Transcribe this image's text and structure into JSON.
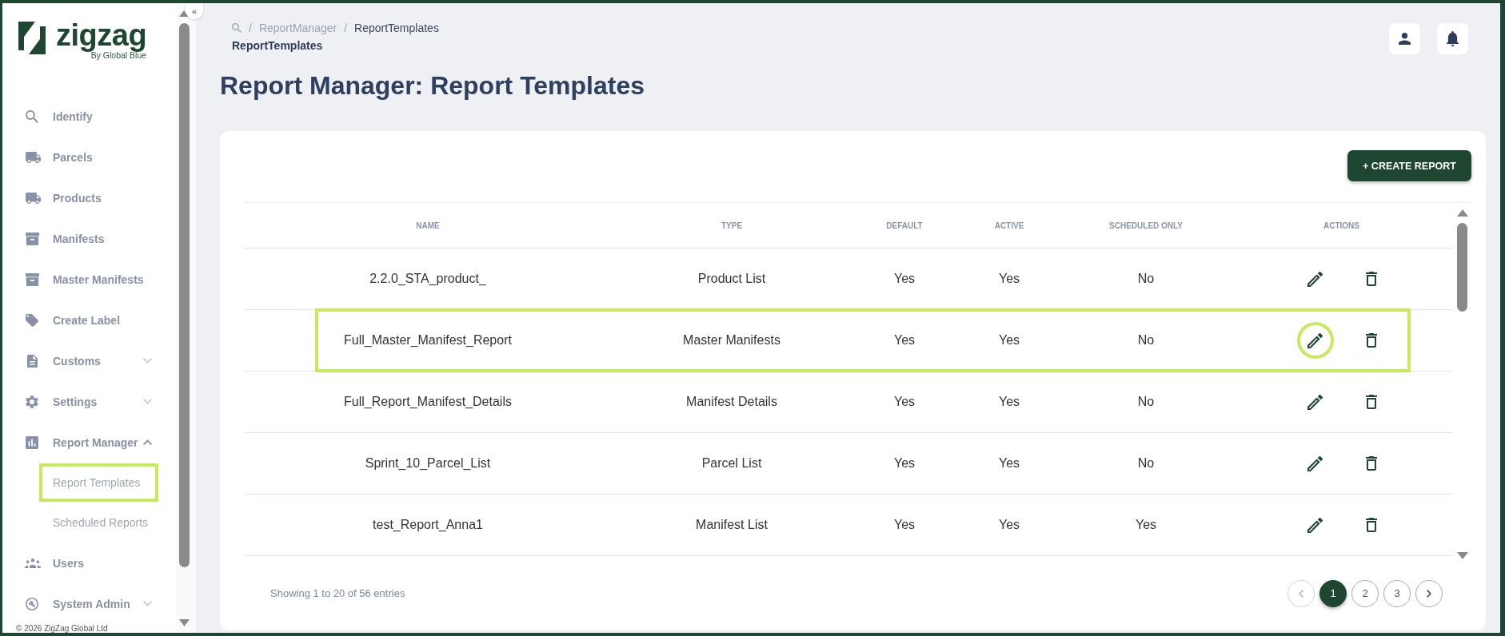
{
  "sidebar": {
    "collapse_button": "«",
    "logo": {
      "wordmark": "zigzag",
      "tagline": "By Global Blue"
    },
    "items": [
      {
        "label": "Identify",
        "kind": "link"
      },
      {
        "label": "Parcels",
        "kind": "link"
      },
      {
        "label": "Products",
        "kind": "link"
      },
      {
        "label": "Manifests",
        "kind": "link"
      },
      {
        "label": "Master Manifests",
        "kind": "link"
      },
      {
        "label": "Create Label",
        "kind": "link"
      },
      {
        "label": "Customs",
        "kind": "group",
        "expanded": false
      },
      {
        "label": "Settings",
        "kind": "group",
        "expanded": false
      },
      {
        "label": "Report Manager",
        "kind": "group",
        "expanded": true,
        "children": [
          {
            "label": "Report Templates",
            "highlighted": true
          },
          {
            "label": "Scheduled Reports",
            "highlighted": false
          }
        ]
      },
      {
        "label": "Users",
        "kind": "link"
      },
      {
        "label": "System Admin",
        "kind": "group",
        "expanded": false
      }
    ],
    "footer": "© 2026 ZigZag Global Ltd"
  },
  "header": {
    "breadcrumb": {
      "items": [
        {
          "separator": "/",
          "label": "ReportManager",
          "current": false
        },
        {
          "separator": "/",
          "label": "ReportTemplates",
          "current": true
        }
      ]
    },
    "page_label": "ReportTemplates",
    "title": "Report Manager: Report Templates"
  },
  "card": {
    "create_button": "+ CREATE REPORT",
    "table": {
      "columns": [
        "NAME",
        "TYPE",
        "DEFAULT",
        "ACTIVE",
        "SCHEDULED ONLY",
        "ACTIONS"
      ],
      "rows": [
        {
          "name": "2.2.0_STA_product_",
          "type": "Product List",
          "default": "Yes",
          "active": "Yes",
          "scheduled_only": "No",
          "highlighted": false,
          "edit_circled": false
        },
        {
          "name": "Full_Master_Manifest_Report",
          "type": "Master Manifests",
          "default": "Yes",
          "active": "Yes",
          "scheduled_only": "No",
          "highlighted": true,
          "edit_circled": true
        },
        {
          "name": "Full_Report_Manifest_Details",
          "type": "Manifest Details",
          "default": "Yes",
          "active": "Yes",
          "scheduled_only": "No",
          "highlighted": false,
          "edit_circled": false
        },
        {
          "name": "Sprint_10_Parcel_List",
          "type": "Parcel List",
          "default": "Yes",
          "active": "Yes",
          "scheduled_only": "No",
          "highlighted": false,
          "edit_circled": false
        },
        {
          "name": "test_Report_Anna1",
          "type": "Manifest List",
          "default": "Yes",
          "active": "Yes",
          "scheduled_only": "Yes",
          "highlighted": false,
          "edit_circled": false
        }
      ]
    },
    "pagination": {
      "summary": "Showing 1 to 20 of 56 entries",
      "previous": {
        "disabled": true
      },
      "pages": [
        {
          "label": "1",
          "selected": true
        },
        {
          "label": "2",
          "selected": false
        },
        {
          "label": "3",
          "selected": false
        }
      ],
      "next": {
        "disabled": false
      }
    }
  }
}
